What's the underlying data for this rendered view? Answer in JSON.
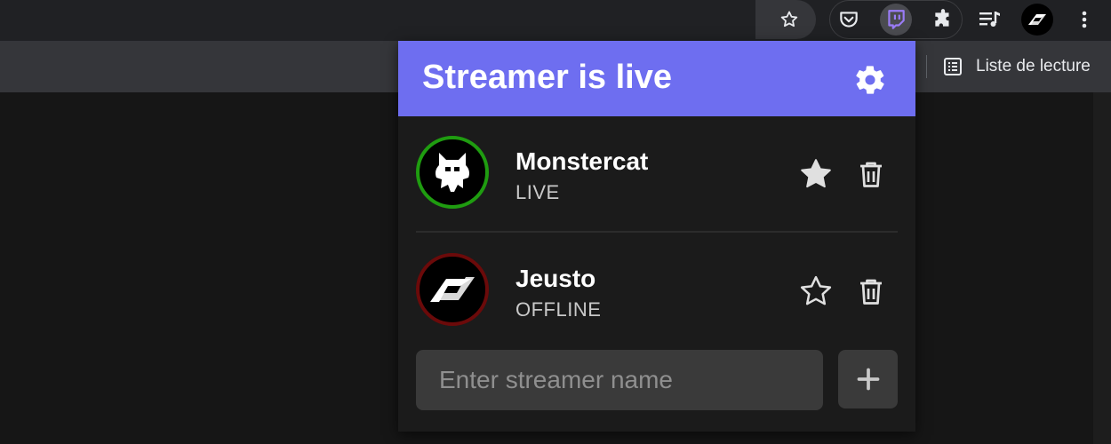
{
  "browser": {
    "toolbar_icons": [
      "star-icon",
      "pocket-icon",
      "twitch-icon",
      "puzzle-icon",
      "media-control-icon",
      "profile-avatar",
      "more-menu-icon"
    ],
    "reading_list_label": "Liste de lecture"
  },
  "popup": {
    "title": "Streamer is live",
    "streamers": [
      {
        "name": "Monstercat",
        "status": "LIVE",
        "favorite": true,
        "status_color": "#1f9c10"
      },
      {
        "name": "Jeusto",
        "status": "OFFLINE",
        "favorite": false,
        "status_color": "#6b0a0a"
      }
    ],
    "input_placeholder": "Enter streamer name",
    "add_icon": "plus-icon"
  },
  "colors": {
    "accent": "#6e6ef0",
    "live": "#1f9c10",
    "offline": "#6b0a0a"
  }
}
